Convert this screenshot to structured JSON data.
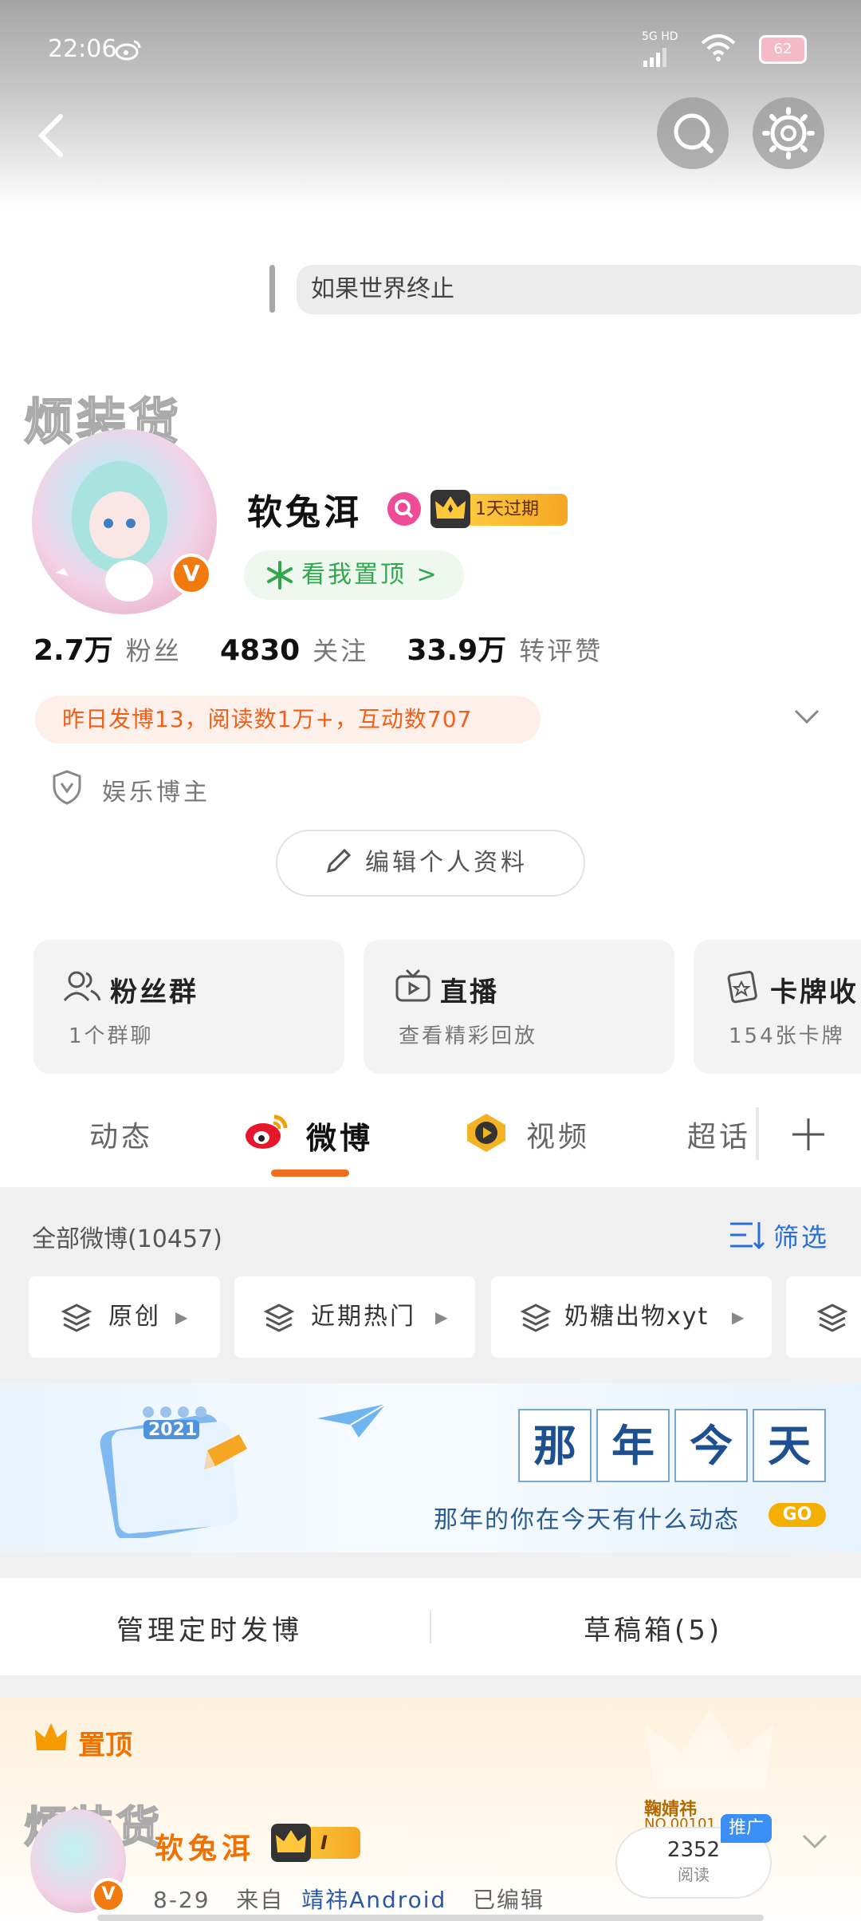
{
  "status": {
    "time": "22:06",
    "network": "5G",
    "hd": "HD",
    "battery": "62"
  },
  "quote": "如果世界终止",
  "watermark": "烦装货",
  "profile": {
    "name": "软兔洱",
    "vip_label": "1天过期",
    "verify_letter": "V",
    "pin_link": "看我置顶 >",
    "stats": [
      {
        "value": "2.7万",
        "label": "粉丝"
      },
      {
        "value": "4830",
        "label": "关注"
      },
      {
        "value": "33.9万",
        "label": "转评赞"
      }
    ],
    "yesterday": "昨日发博13，阅读数1万+，互动数707",
    "category": "娱乐博主",
    "edit_label": "编辑个人资料"
  },
  "cards": [
    {
      "title": "粉丝群",
      "sub": "1个群聊",
      "icon": "group-icon"
    },
    {
      "title": "直播",
      "sub": "查看精彩回放",
      "icon": "tv-icon"
    },
    {
      "title": "卡牌收",
      "sub": "154张卡牌",
      "icon": "card-icon"
    }
  ],
  "tabs": [
    "动态",
    "微博",
    "视频",
    "超话"
  ],
  "active_tab": "微博",
  "feed": {
    "all_label": "全部微博(10457)",
    "filter_label": "筛选",
    "chips": [
      "原创",
      "近期热门",
      "奶糖出物xyt"
    ]
  },
  "banner": {
    "year": "2021",
    "chars": [
      "那",
      "年",
      "今",
      "天"
    ],
    "subtitle": "那年的你在今天有什么动态",
    "go": "GO"
  },
  "manage": {
    "scheduled": "管理定时发博",
    "drafts": "草稿箱(5)"
  },
  "pinned": {
    "title": "置顶",
    "author": "软兔洱",
    "vip_level": "I",
    "date": "8-29",
    "from": "来自",
    "source": "靖祎Android",
    "edited": "已编辑",
    "sponsor": "鞠婧祎",
    "sponsor_no": "NO.00101",
    "promo": "推广",
    "reads": "2352",
    "reads_label": "阅读"
  },
  "colors": {
    "accent": "#f26c1e",
    "link": "#2b6fd6",
    "pin_green": "#31a64d"
  }
}
